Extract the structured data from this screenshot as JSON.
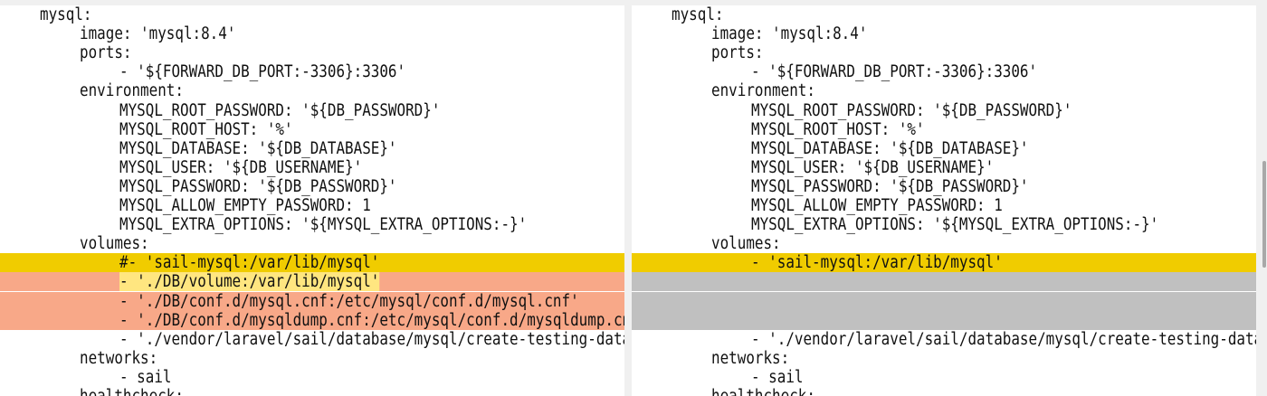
{
  "left_pane": {
    "lines": [
      {
        "indent": 2,
        "text": "mysql:",
        "state": "normal"
      },
      {
        "indent": 4,
        "text": "image: 'mysql:8.4'",
        "state": "normal"
      },
      {
        "indent": 4,
        "text": "ports:",
        "state": "normal"
      },
      {
        "indent": 6,
        "text": "- '${FORWARD_DB_PORT:-3306}:3306'",
        "state": "normal"
      },
      {
        "indent": 4,
        "text": "environment:",
        "state": "normal"
      },
      {
        "indent": 6,
        "text": "MYSQL_ROOT_PASSWORD: '${DB_PASSWORD}'",
        "state": "normal"
      },
      {
        "indent": 6,
        "text": "MYSQL_ROOT_HOST: '%'",
        "state": "normal"
      },
      {
        "indent": 6,
        "text": "MYSQL_DATABASE: '${DB_DATABASE}'",
        "state": "normal"
      },
      {
        "indent": 6,
        "text": "MYSQL_USER: '${DB_USERNAME}'",
        "state": "normal"
      },
      {
        "indent": 6,
        "text": "MYSQL_PASSWORD: '${DB_PASSWORD}'",
        "state": "normal"
      },
      {
        "indent": 6,
        "text": "MYSQL_ALLOW_EMPTY_PASSWORD: 1",
        "state": "normal"
      },
      {
        "indent": 6,
        "text": "MYSQL_EXTRA_OPTIONS: '${MYSQL_EXTRA_OPTIONS:-}'",
        "state": "normal"
      },
      {
        "indent": 4,
        "text": "volumes:",
        "state": "normal"
      },
      {
        "indent": 6,
        "text": "#- 'sail-mysql:/var/lib/mysql'",
        "state": "changed"
      },
      {
        "indent": 6,
        "text": "- './DB/volume:/var/lib/mysql'",
        "state": "removed"
      },
      {
        "indent": 6,
        "text": "- './DB/conf.d/mysql.cnf:/etc/mysql/conf.d/mysql.cnf'",
        "state": "removed"
      },
      {
        "indent": 6,
        "text": "- './DB/conf.d/mysqldump.cnf:/etc/mysql/conf.d/mysqldump.cnf'",
        "state": "removed"
      },
      {
        "indent": 6,
        "text": "- './vendor/laravel/sail/database/mysql/create-testing-database.sh'",
        "state": "normal"
      },
      {
        "indent": 4,
        "text": "networks:",
        "state": "normal"
      },
      {
        "indent": 6,
        "text": "- sail",
        "state": "normal"
      },
      {
        "indent": 4,
        "text": "healthcheck:",
        "state": "normal"
      }
    ]
  },
  "right_pane": {
    "lines": [
      {
        "indent": 2,
        "text": "mysql:",
        "state": "normal"
      },
      {
        "indent": 4,
        "text": "image: 'mysql:8.4'",
        "state": "normal"
      },
      {
        "indent": 4,
        "text": "ports:",
        "state": "normal"
      },
      {
        "indent": 6,
        "text": "- '${FORWARD_DB_PORT:-3306}:3306'",
        "state": "normal"
      },
      {
        "indent": 4,
        "text": "environment:",
        "state": "normal"
      },
      {
        "indent": 6,
        "text": "MYSQL_ROOT_PASSWORD: '${DB_PASSWORD}'",
        "state": "normal"
      },
      {
        "indent": 6,
        "text": "MYSQL_ROOT_HOST: '%'",
        "state": "normal"
      },
      {
        "indent": 6,
        "text": "MYSQL_DATABASE: '${DB_DATABASE}'",
        "state": "normal"
      },
      {
        "indent": 6,
        "text": "MYSQL_USER: '${DB_USERNAME}'",
        "state": "normal"
      },
      {
        "indent": 6,
        "text": "MYSQL_PASSWORD: '${DB_PASSWORD}'",
        "state": "normal"
      },
      {
        "indent": 6,
        "text": "MYSQL_ALLOW_EMPTY_PASSWORD: 1",
        "state": "normal"
      },
      {
        "indent": 6,
        "text": "MYSQL_EXTRA_OPTIONS: '${MYSQL_EXTRA_OPTIONS:-}'",
        "state": "normal"
      },
      {
        "indent": 4,
        "text": "volumes:",
        "state": "normal"
      },
      {
        "indent": 6,
        "text": "- 'sail-mysql:/var/lib/mysql'",
        "state": "changed"
      },
      {
        "indent": 0,
        "text": "",
        "state": "filler"
      },
      {
        "indent": 0,
        "text": "",
        "state": "filler"
      },
      {
        "indent": 0,
        "text": "",
        "state": "filler"
      },
      {
        "indent": 6,
        "text": "- './vendor/laravel/sail/database/mysql/create-testing-database.sh'",
        "state": "normal"
      },
      {
        "indent": 4,
        "text": "networks:",
        "state": "normal"
      },
      {
        "indent": 6,
        "text": "- sail",
        "state": "normal"
      },
      {
        "indent": 4,
        "text": "healthcheck:",
        "state": "normal"
      }
    ]
  },
  "colors": {
    "changed": "#f0cc00",
    "removed": "#f8a888",
    "filler": "#c0c0c0"
  }
}
